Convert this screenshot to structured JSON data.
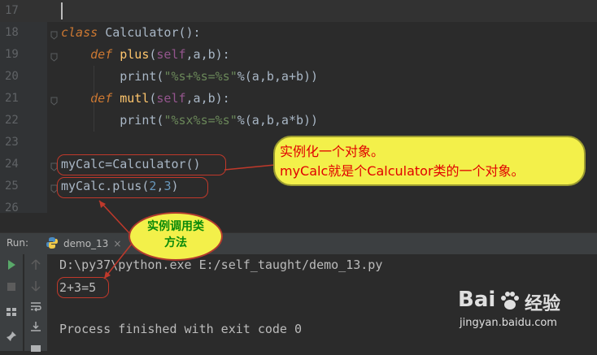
{
  "editor": {
    "lines": [
      {
        "num": "17",
        "code": [],
        "current": true
      },
      {
        "num": "18",
        "code": [
          {
            "t": "class ",
            "c": "kw"
          },
          {
            "t": "Calculator():",
            "c": ""
          }
        ]
      },
      {
        "num": "19",
        "code": [
          {
            "t": "    def ",
            "c": "kw"
          },
          {
            "t": "plus",
            "c": "fn"
          },
          {
            "t": "(",
            "c": ""
          },
          {
            "t": "self",
            "c": "slf"
          },
          {
            "t": ",a,b):",
            "c": ""
          }
        ]
      },
      {
        "num": "20",
        "code": [
          {
            "t": "        print(",
            "c": ""
          },
          {
            "t": "\"%s+%s=%s\"",
            "c": "str"
          },
          {
            "t": "%(a,b,a+b))",
            "c": ""
          }
        ]
      },
      {
        "num": "21",
        "code": [
          {
            "t": "    def ",
            "c": "kw"
          },
          {
            "t": "mutl",
            "c": "fn"
          },
          {
            "t": "(",
            "c": ""
          },
          {
            "t": "self",
            "c": "slf"
          },
          {
            "t": ",a,b):",
            "c": ""
          }
        ]
      },
      {
        "num": "22",
        "code": [
          {
            "t": "        print(",
            "c": ""
          },
          {
            "t": "\"%sx%s=%s\"",
            "c": "str"
          },
          {
            "t": "%(a,b,a*b))",
            "c": ""
          }
        ]
      },
      {
        "num": "23",
        "code": []
      },
      {
        "num": "24",
        "code": [
          {
            "t": "myCalc=Calculator()",
            "c": ""
          }
        ]
      },
      {
        "num": "25",
        "code": [
          {
            "t": "myCalc.plus(",
            "c": ""
          },
          {
            "t": "2",
            "c": "num"
          },
          {
            "t": ",",
            "c": ""
          },
          {
            "t": "3",
            "c": "num"
          },
          {
            "t": ")",
            "c": ""
          }
        ]
      },
      {
        "num": "26",
        "code": []
      }
    ]
  },
  "run": {
    "label": "Run:",
    "tab_name": "demo_13",
    "tab_close": "×",
    "console": [
      "D:\\py37\\python.exe E:/self_taught/demo_13.py",
      "2+3=5",
      "",
      "Process finished with exit code 0"
    ]
  },
  "annotations": {
    "callout_object_line1": "实例化一个对象。",
    "callout_object_line2": "myCalc就是个Calculator类的一个对象。",
    "callout_method_line1": "实例调用类",
    "callout_method_line2": "方法"
  },
  "watermark": {
    "brand_left": "Bai",
    "brand_right": "经验",
    "url": "jingyan.baidu.com"
  },
  "colors": {
    "keyword": "#cc7832",
    "self": "#94558d",
    "string": "#6a8759",
    "number": "#6897bb",
    "function": "#ffc66d",
    "annotation_red": "#c0392b",
    "callout_yellow": "#f3f04a"
  }
}
